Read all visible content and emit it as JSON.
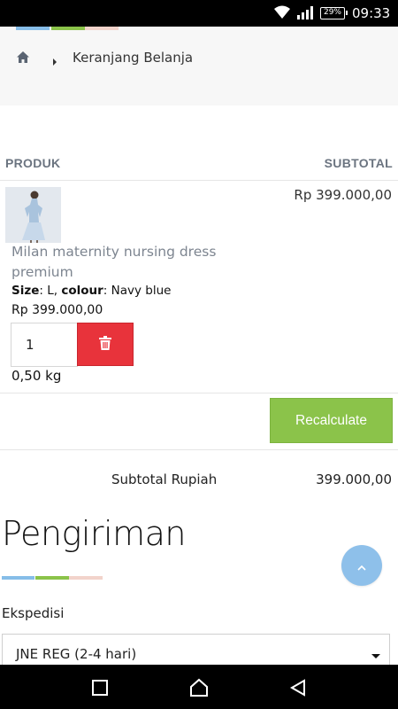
{
  "status_bar": {
    "battery": "29%",
    "time": "09:33",
    "icons": [
      "wifi-icon",
      "signal-icon",
      "battery-icon"
    ]
  },
  "breadcrumb": {
    "home_icon": "home-icon",
    "separator_icon": "chevron-right-icon",
    "current": "Keranjang Belanja"
  },
  "accent_colors": {
    "blue": "#86bde8",
    "green": "#8bc34a",
    "pink": "#f2d3cb",
    "danger": "#e8333b"
  },
  "cart": {
    "header": {
      "product": "PRODUK",
      "subtotal": "SUBTOTAL"
    },
    "items": [
      {
        "name": "Milan maternity nursing dress premium",
        "size_label": "Size",
        "size_value": ": L, ",
        "colour_label": "colour",
        "colour_value": ": Navy blue",
        "price": "Rp 399.000,00",
        "quantity": "1",
        "weight": "0,50 kg",
        "subtotal": "Rp 399.000,00",
        "delete_icon": "trash-icon"
      }
    ],
    "recalculate_label": "Recalculate",
    "summary": {
      "label": "Subtotal Rupiah",
      "value": "399.000,00"
    }
  },
  "shipping": {
    "title": "Pengiriman",
    "field_label": "Ekspedisi",
    "selected": "JNE REG (2-4 hari)",
    "dropdown_icon": "caret-down-icon"
  },
  "fab_icon": "chevron-up-icon",
  "nav_bar": {
    "icons": [
      "recent-apps-icon",
      "home-nav-icon",
      "back-icon"
    ]
  }
}
